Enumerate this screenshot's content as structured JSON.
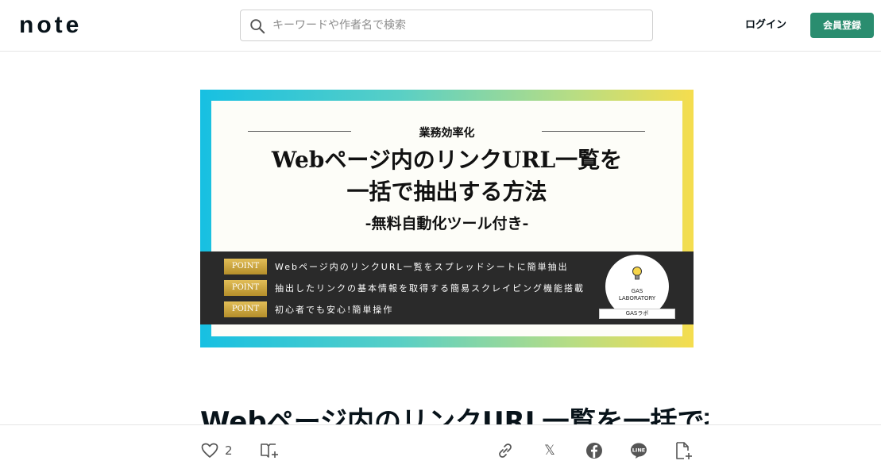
{
  "header": {
    "logo": "note",
    "search_placeholder": "キーワードや作者名で検索",
    "login_label": "ログイン",
    "signup_label": "会員登録"
  },
  "thumbnail": {
    "kicker": "業務効率化",
    "title_line1": "Webページ内のリンクURL一覧を",
    "title_line2": "一括で抽出する方法",
    "subtitle": "-無料自動化ツール付き-",
    "points": [
      {
        "badge": "POINT",
        "text": "Webページ内のリンクURL一覧をスプレッドシートに簡単抽出"
      },
      {
        "badge": "POINT",
        "text": "抽出したリンクの基本情報を取得する簡易スクレイピング機能搭載"
      },
      {
        "badge": "POINT",
        "text": "初心者でも安心!簡単操作"
      }
    ],
    "gas_label_line1": "GAS",
    "gas_label_line2": "LABORATORY",
    "gas_tag": "GASラボ"
  },
  "article": {
    "title": "Webページ内のリンクURL一覧を一括で抽"
  },
  "actions": {
    "like_count": "2",
    "x_label": "𝕏"
  },
  "colors": {
    "accent_green": "#2a8d6f",
    "text_dark": "#08131a"
  }
}
